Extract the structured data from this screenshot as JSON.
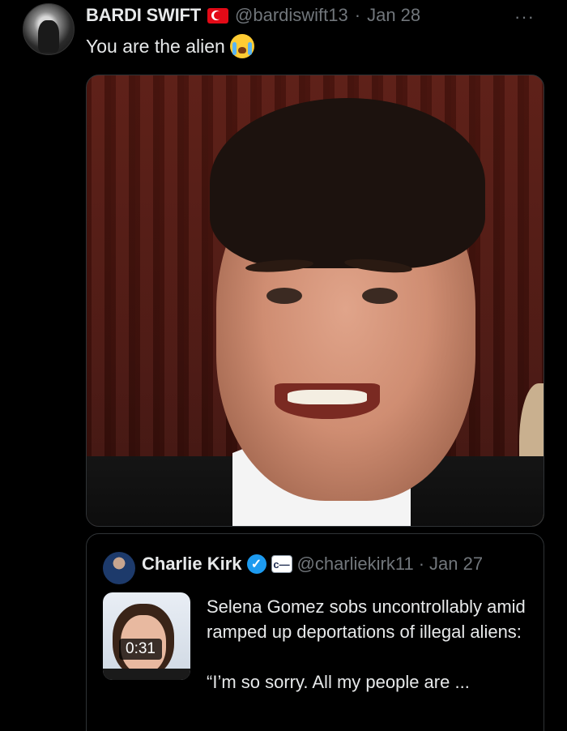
{
  "tweet": {
    "display_name": "BARDI SWIFT",
    "handle": "@bardiswift13",
    "separator": "·",
    "date": "Jan 28",
    "text": "You are the alien",
    "emoji": "loudly-crying-face",
    "flag": "turkey-flag",
    "more": "···"
  },
  "quoted": {
    "display_name": "Charlie Kirk",
    "verified_mark": "✓",
    "affiliation_icon": "affiliate-badge",
    "affiliation_mark": "c—",
    "handle": "@charliekirk11",
    "separator": "·",
    "date": "Jan 27",
    "video_duration": "0:31",
    "text_line1": "Selena Gomez sobs uncontrollably amid ramped up deportations of illegal aliens:",
    "text_line2": "“I’m so sorry. All my people are ..."
  },
  "colors": {
    "background": "#000000",
    "text": "#e7e9ea",
    "secondary": "#71767b",
    "verified": "#1d9bf0",
    "border": "#2f3336"
  }
}
